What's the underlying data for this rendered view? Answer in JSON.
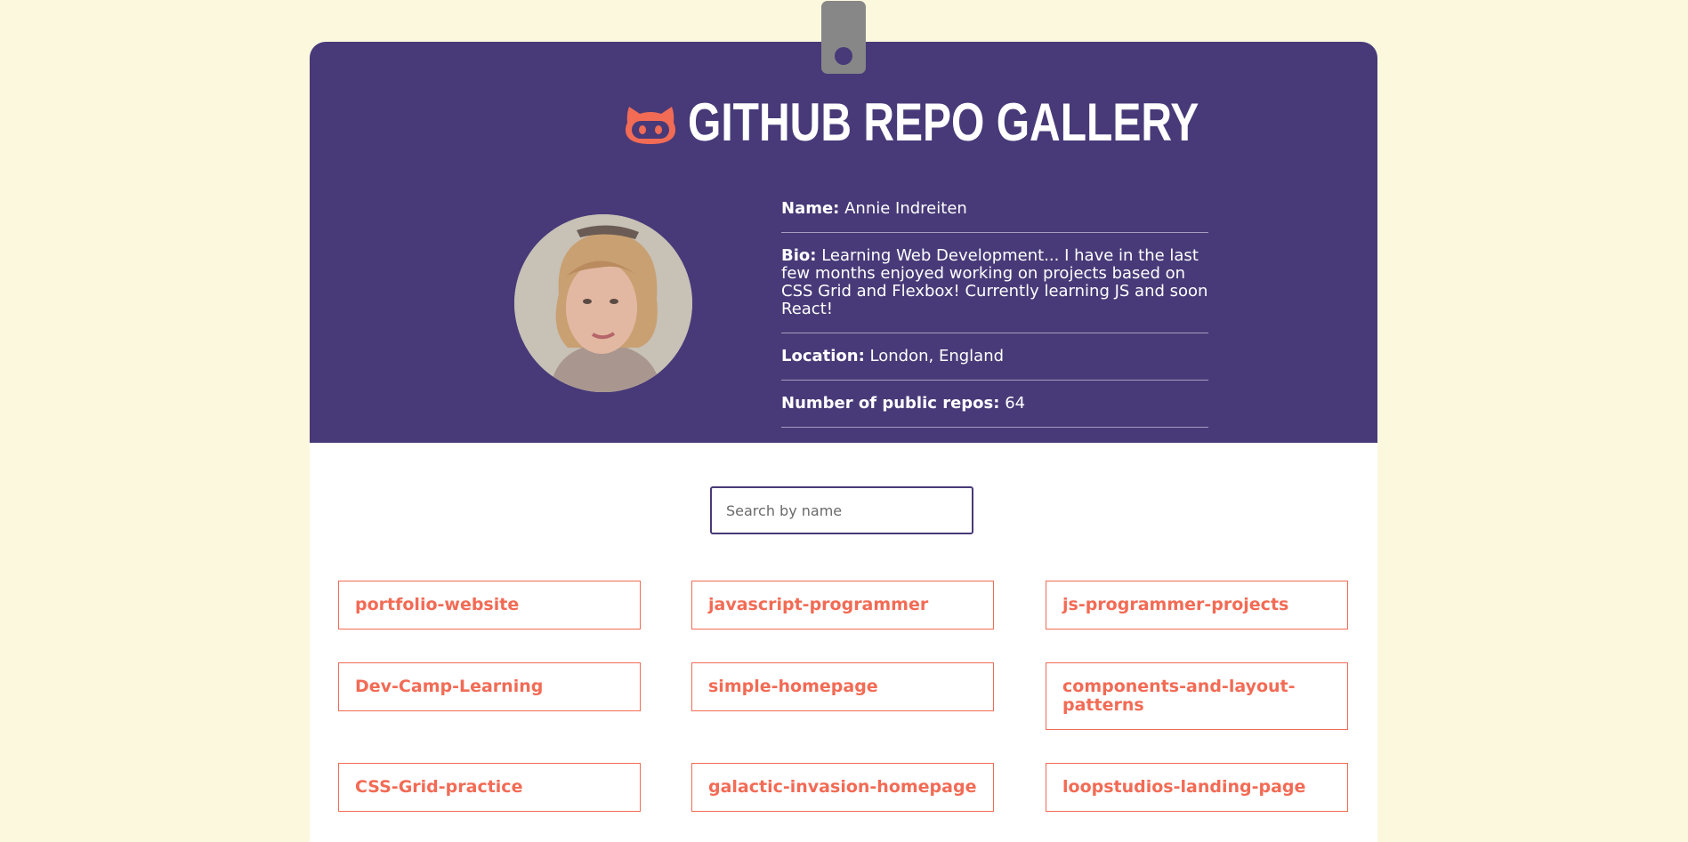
{
  "header": {
    "title": "GITHUB REPO GALLERY"
  },
  "profile": {
    "name_label": "Name:",
    "name_value": "Annie Indreiten",
    "bio_label": "Bio:",
    "bio_value": "Learning Web Development... I have in the last few months enjoyed working on projects based on CSS Grid and Flexbox! Currently learning JS and soon React!",
    "location_label": "Location:",
    "location_value": "London, England",
    "repos_label": "Number of public repos:",
    "repos_value": "64"
  },
  "search": {
    "placeholder": "Search by name"
  },
  "repos": [
    "portfolio-website",
    "javascript-programmer",
    "js-programmer-projects",
    "Dev-Camp-Learning",
    "simple-homepage",
    "components-and-layout-patterns",
    "CSS-Grid-practice",
    "galactic-invasion-homepage",
    "loopstudios-landing-page"
  ],
  "colors": {
    "background": "#fbf8de",
    "header": "#483a78",
    "accent": "#f26b55"
  },
  "icons": {
    "logo": "octocat-icon",
    "clip": "clipboard-clip-icon"
  }
}
